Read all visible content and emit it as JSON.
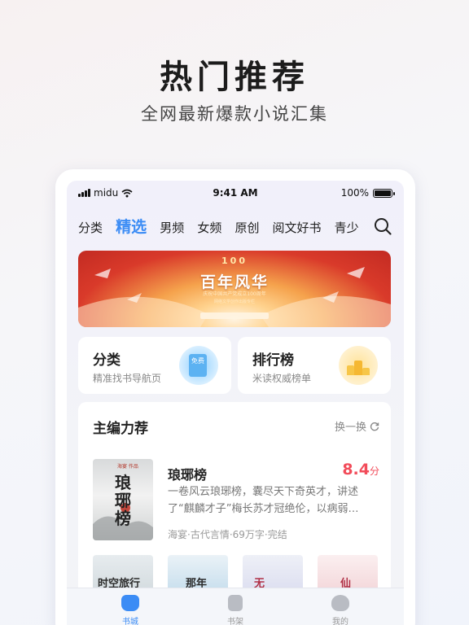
{
  "hero": {
    "title": "热门推荐",
    "subtitle": "全网最新爆款小说汇集"
  },
  "status_bar": {
    "carrier": "midu",
    "time": "9:41 AM",
    "battery": "100%",
    "battery_level": 1.0
  },
  "nav_tabs": [
    {
      "label": "分类",
      "active": false
    },
    {
      "label": "精选",
      "active": true
    },
    {
      "label": "男频",
      "active": false
    },
    {
      "label": "女频",
      "active": false
    },
    {
      "label": "原创",
      "active": false
    },
    {
      "label": "阅文好书",
      "active": false
    },
    {
      "label": "青少",
      "active": false
    }
  ],
  "banner": {
    "logo": "100",
    "title": "百年风华",
    "caption": "庆祝中国共产党成立100周年",
    "caption2": "网络文学创作出版专栏"
  },
  "shortcuts": {
    "category": {
      "title": "分类",
      "subtitle": "精准找书导航页",
      "icon_text": "免费"
    },
    "ranking": {
      "title": "排行榜",
      "subtitle": "米读权威榜单"
    }
  },
  "recommend": {
    "title": "主编力荐",
    "refresh_label": "换一换",
    "book": {
      "cover_text": "琅琊榜",
      "cover_tag": "海宴 作品",
      "name": "琅琊榜",
      "score": "8.4",
      "score_unit": "分",
      "description": "一卷风云琅琊榜，囊尽天下奇英才，讲述了“麒麟才子”梅长苏才冠绝伦，以病弱…",
      "meta": "海宴·古代言情·69万字·完结"
    },
    "thumbnails": [
      {
        "text": "时空旅行"
      },
      {
        "text": "那年"
      },
      {
        "text": "无"
      },
      {
        "text": "仙"
      }
    ]
  },
  "tabbar": [
    {
      "label": "书城",
      "active": true
    },
    {
      "label": "书架",
      "active": false
    },
    {
      "label": "我的",
      "active": false
    }
  ],
  "colors": {
    "accent": "#3b8cf5",
    "score": "#f24c5a"
  }
}
